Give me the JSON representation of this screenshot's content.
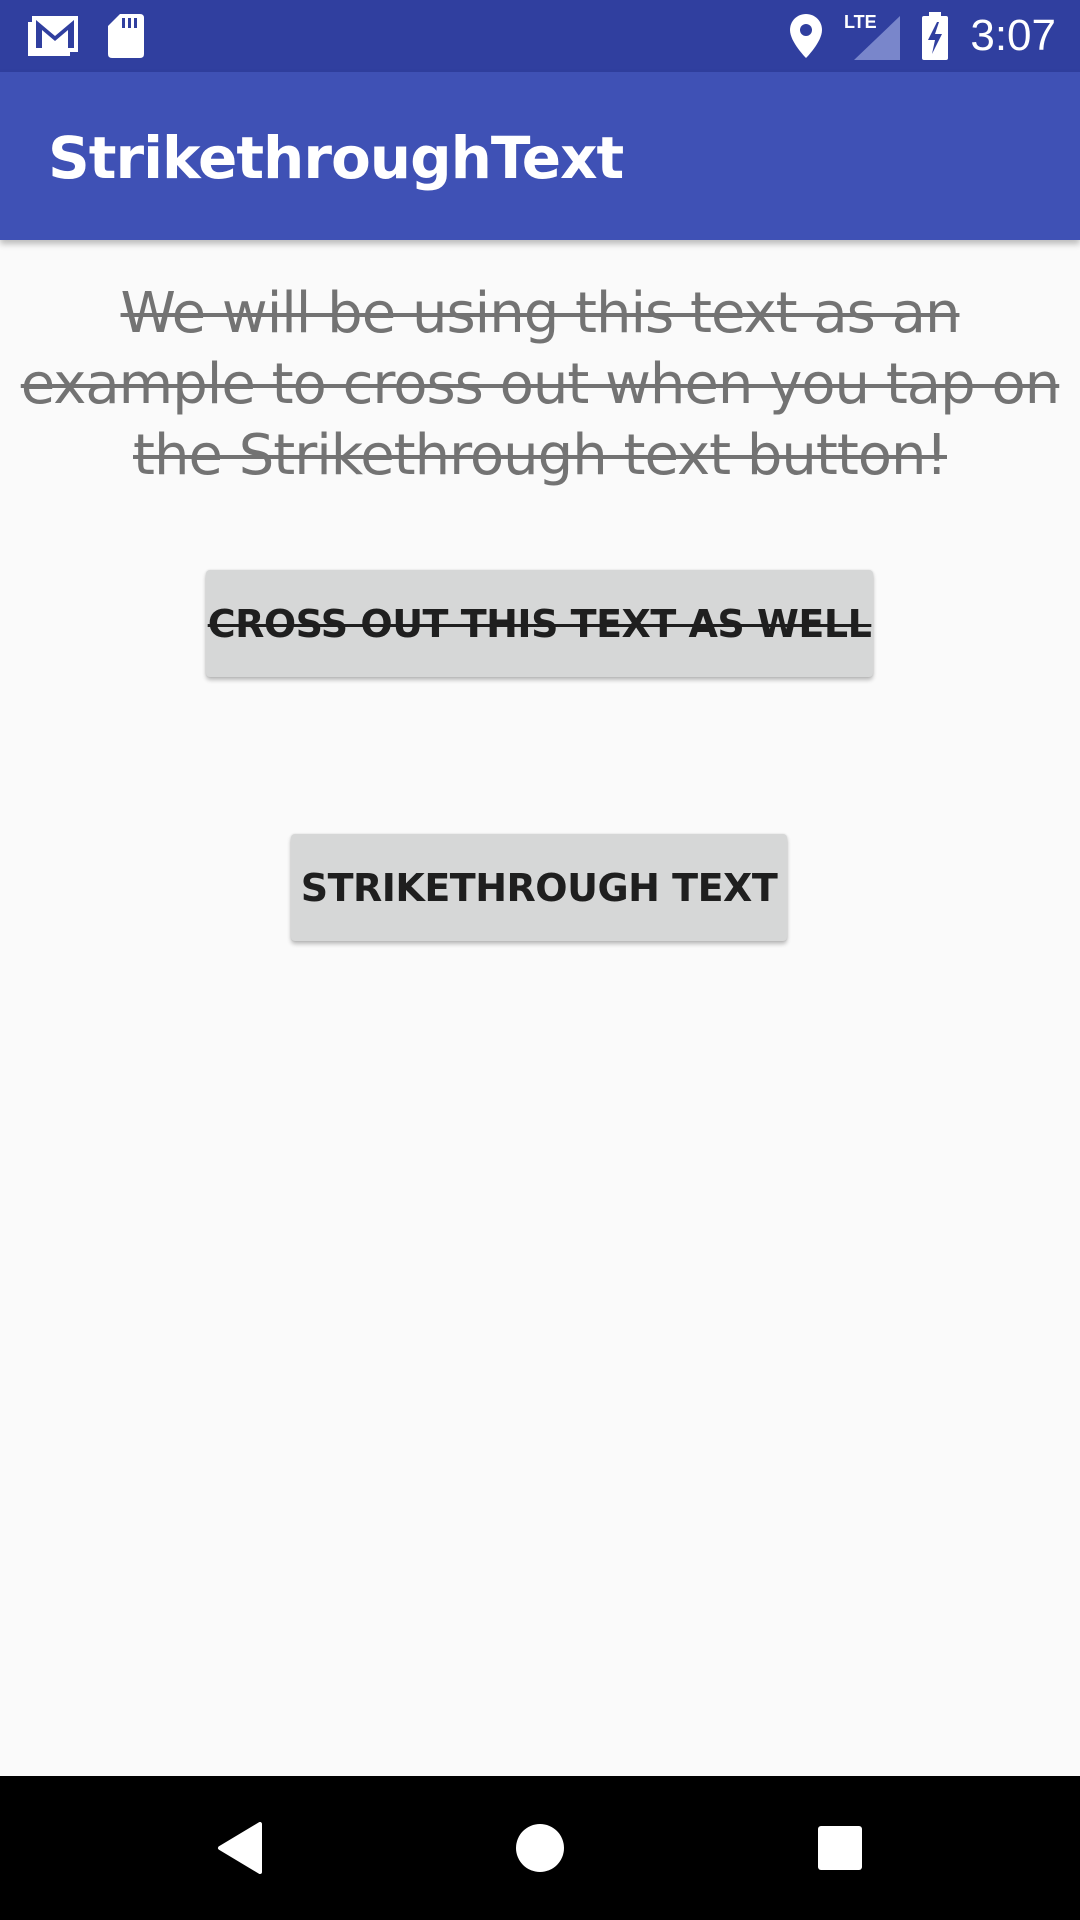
{
  "status_bar": {
    "time": "3:07",
    "icons": [
      "gmail-icon",
      "sd-card-icon",
      "location-icon",
      "lte-signal-icon",
      "battery-charging-icon"
    ],
    "lte_label": "LTE",
    "color": "#303f9f"
  },
  "app_bar": {
    "title": "StrikethroughText",
    "color": "#3f51b5"
  },
  "main": {
    "example_text": "We will be using this text as an example to cross out when you tap on the Strikethrough text button!",
    "cross_out_button_label": "CROSS OUT THIS TEXT AS WELL",
    "strikethrough_button_label": "STRIKETHROUGH TEXT"
  },
  "nav_bar": {
    "buttons": [
      "back-icon",
      "home-icon",
      "recents-icon"
    ]
  }
}
